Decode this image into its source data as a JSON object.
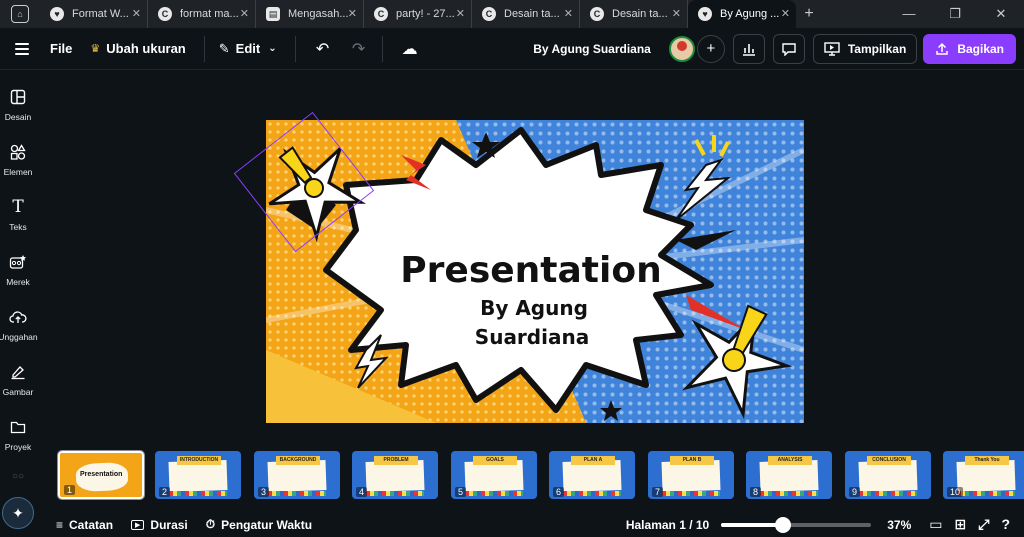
{
  "tabs": [
    {
      "label": "Format W...",
      "fav": "♥",
      "active": false
    },
    {
      "label": "format ma...",
      "fav": "C",
      "active": false
    },
    {
      "label": "Mengasah...",
      "fav": "▤",
      "active": false
    },
    {
      "label": "party! - 27...",
      "fav": "C",
      "active": false
    },
    {
      "label": "Desain ta...",
      "fav": "C",
      "active": false
    },
    {
      "label": "Desain ta...",
      "fav": "C",
      "active": false
    },
    {
      "label": "By Agung ...",
      "fav": "♥",
      "active": true
    }
  ],
  "toolbar": {
    "file": "File",
    "resize": "Ubah ukuran",
    "edit": "Edit",
    "author": "By Agung Suardiana",
    "present": "Tampilkan",
    "share": "Bagikan"
  },
  "sidebar": [
    {
      "label": "Desain",
      "icon": "layout-icon"
    },
    {
      "label": "Elemen",
      "icon": "shapes-icon"
    },
    {
      "label": "Teks",
      "icon": "text-icon"
    },
    {
      "label": "Merek",
      "icon": "brand-icon"
    },
    {
      "label": "Unggahan",
      "icon": "upload-icon"
    },
    {
      "label": "Gambar",
      "icon": "draw-icon"
    },
    {
      "label": "Proyek",
      "icon": "folder-icon"
    }
  ],
  "slide": {
    "title": "Presentation",
    "subtitle_line1": "By Agung",
    "subtitle_line2": "Suardiana"
  },
  "thumbnails": [
    {
      "num": "1",
      "title": "Presentation"
    },
    {
      "num": "2",
      "title": "INTRODUCTION"
    },
    {
      "num": "3",
      "title": "BACKGROUND"
    },
    {
      "num": "4",
      "title": "PROBLEM"
    },
    {
      "num": "5",
      "title": "GOALS"
    },
    {
      "num": "6",
      "title": "PLAN A"
    },
    {
      "num": "7",
      "title": "PLAN B"
    },
    {
      "num": "8",
      "title": "ANALYSIS"
    },
    {
      "num": "9",
      "title": "CONCLUSION"
    },
    {
      "num": "10",
      "title": "Thank You"
    }
  ],
  "bottom": {
    "notes": "Catatan",
    "duration": "Durasi",
    "timer": "Pengatur Waktu",
    "page": "Halaman 1 / 10",
    "zoom": "37%",
    "zoom_value": 37
  },
  "colors": {
    "accent": "#8b3dff",
    "bg": "#0e1318"
  }
}
